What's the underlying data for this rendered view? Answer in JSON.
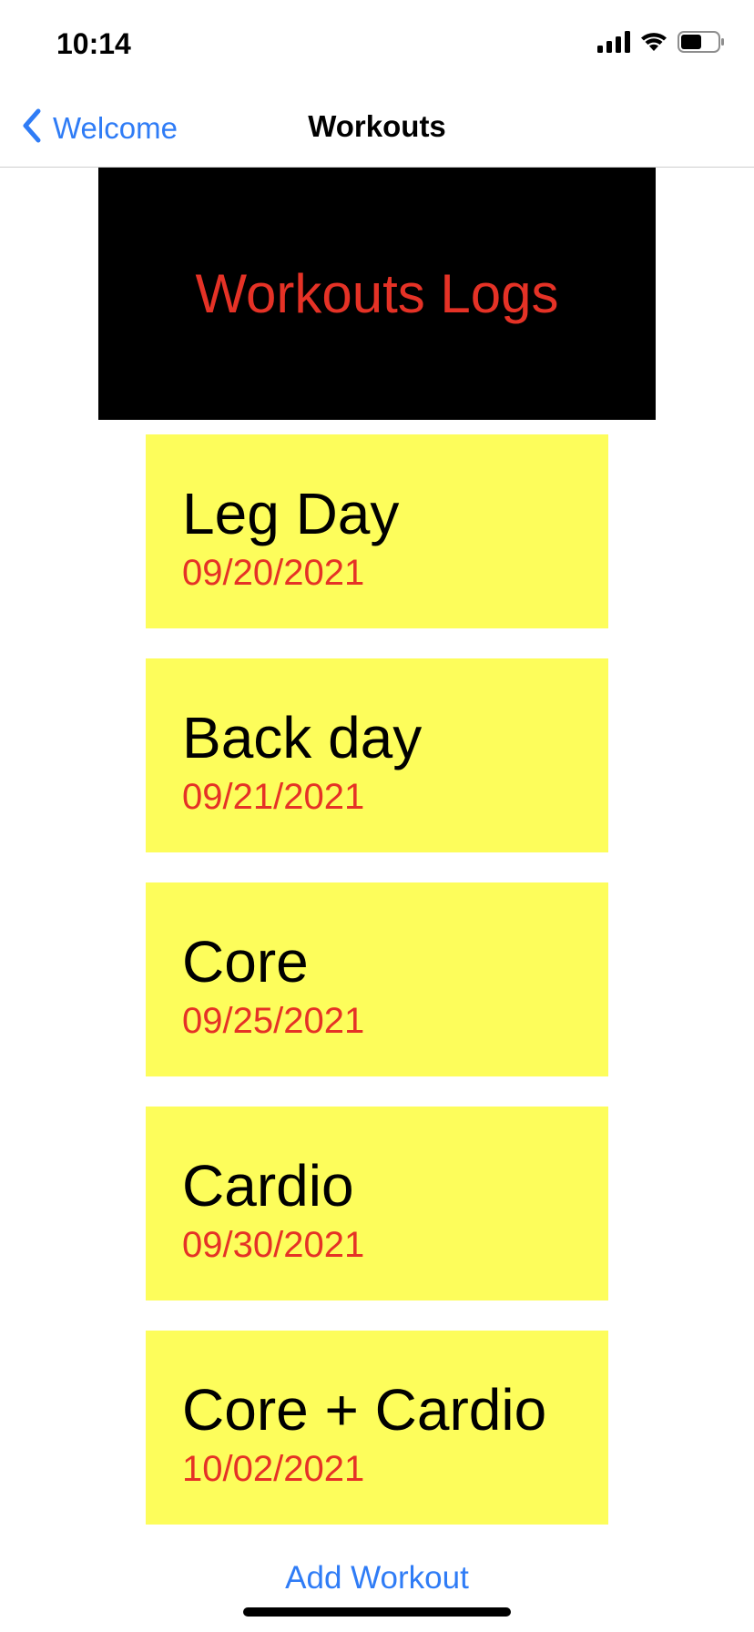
{
  "status_bar": {
    "time": "10:14",
    "icons": [
      "signal-icon",
      "wifi-icon",
      "battery-icon"
    ]
  },
  "nav": {
    "back_label": "Welcome",
    "title": "Workouts"
  },
  "header": {
    "title": "Workouts Logs"
  },
  "workouts": [
    {
      "name": "Leg Day",
      "date": "09/20/2021"
    },
    {
      "name": "Back day",
      "date": "09/21/2021"
    },
    {
      "name": "Core",
      "date": "09/25/2021"
    },
    {
      "name": "Cardio",
      "date": "09/30/2021"
    },
    {
      "name": "Core + Cardio",
      "date": "10/02/2021"
    }
  ],
  "actions": {
    "add_workout_label": "Add Workout"
  },
  "colors": {
    "accent": "#2f7cf6",
    "date_red": "#e53226",
    "card_yellow": "#fdfd5b",
    "banner_black": "#000000"
  }
}
